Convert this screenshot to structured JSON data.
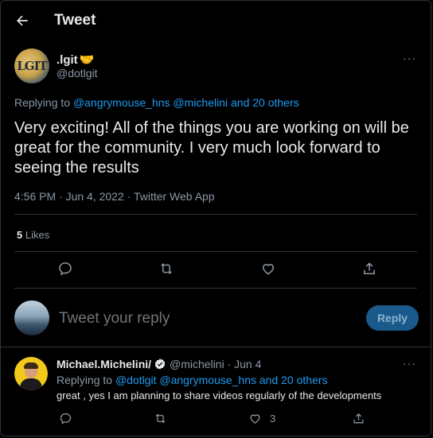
{
  "header": {
    "title": "Tweet"
  },
  "tweet": {
    "avatar_text": "LGIT",
    "display_name": ".lgit",
    "name_emoji": "🤝",
    "handle": "@dotlgit",
    "replying_prefix": "Replying to",
    "replying_links": "@angrymouse_hns @michelini and 20 others",
    "text": "Very exciting! All of the things you are working on will be great for the community. I very much look forward to seeing the results",
    "timestamp": "4:56 PM · Jun 4, 2022 · Twitter Web App",
    "likes_count": "5",
    "likes_label": "Likes",
    "more": "···"
  },
  "composer": {
    "placeholder": "Tweet your reply",
    "reply_button": "Reply"
  },
  "reply": {
    "display_name": "Michael.Michelini/",
    "handle_date": "@michelini · Jun 4",
    "replying_prefix": "Replying to",
    "replying_links": "@dotlgit @angrymouse_hns and 20 others",
    "text": "great , yes I am planning to share videos regularly of the developments",
    "like_count": "3",
    "more": "···"
  },
  "icons": {
    "back": "arrow-left-icon",
    "reply": "comment-icon",
    "retweet": "retweet-icon",
    "like": "heart-icon",
    "share": "share-icon",
    "verified": "verified-badge-icon"
  },
  "colors": {
    "background": "#000000",
    "accent": "#1d9bf0",
    "muted": "#8b98a5",
    "text": "#e7e9ea"
  }
}
